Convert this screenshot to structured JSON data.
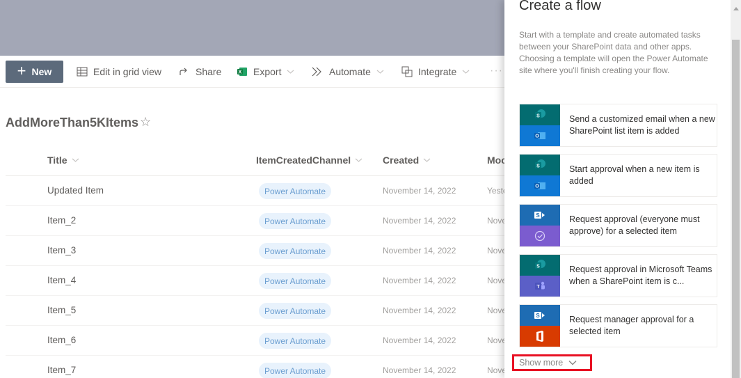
{
  "command_bar": {
    "new_label": "New",
    "edit_grid_label": "Edit in grid view",
    "share_label": "Share",
    "export_label": "Export",
    "automate_label": "Automate",
    "integrate_label": "Integrate",
    "more_label": "···"
  },
  "list": {
    "title": "AddMoreThan5KItems",
    "columns": {
      "title": "Title",
      "channel": "ItemCreatedChannel",
      "created": "Created",
      "modified": "Moc"
    },
    "rows": [
      {
        "title": "Updated Item",
        "channel": "Power Automate",
        "created": "November 14, 2022",
        "modified": "Yeste"
      },
      {
        "title": "Item_2",
        "channel": "Power Automate",
        "created": "November 14, 2022",
        "modified": "Nove"
      },
      {
        "title": "Item_3",
        "channel": "Power Automate",
        "created": "November 14, 2022",
        "modified": "Nove"
      },
      {
        "title": "Item_4",
        "channel": "Power Automate",
        "created": "November 14, 2022",
        "modified": "Nove"
      },
      {
        "title": "Item_5",
        "channel": "Power Automate",
        "created": "November 14, 2022",
        "modified": "Nove"
      },
      {
        "title": "Item_6",
        "channel": "Power Automate",
        "created": "November 14, 2022",
        "modified": "Nove"
      },
      {
        "title": "Item_7",
        "channel": "Power Automate",
        "created": "November 14, 2022",
        "modified": "Nove"
      }
    ]
  },
  "panel": {
    "title": "Create a flow",
    "description": "Start with a template and create automated tasks between your SharePoint data and other apps. Choosing a template will open the Power Automate site where you'll finish creating your flow.",
    "templates": [
      {
        "text": "Send a customized email when a new SharePoint list item is added",
        "top_icon": "sharepoint-icon",
        "bottom_icon": "outlook-icon"
      },
      {
        "text": "Start approval when a new item is added",
        "top_icon": "sharepoint-icon",
        "bottom_icon": "outlook-icon"
      },
      {
        "text": "Request approval (everyone must approve) for a selected item",
        "top_icon": "sharepoint-icon",
        "bottom_icon": "approvals-icon"
      },
      {
        "text": "Request approval in Microsoft Teams when a SharePoint item is c...",
        "top_icon": "sharepoint-icon",
        "bottom_icon": "teams-icon"
      },
      {
        "text": "Request manager approval for a selected item",
        "top_icon": "sharepoint-icon",
        "bottom_icon": "office-icon"
      }
    ],
    "show_more_label": "Show more"
  },
  "colors": {
    "sharepoint_teal": "#036c70",
    "sharepoint_blue": "#1e6cb3",
    "outlook_blue": "#0f78d4",
    "approvals_purple": "#7b5ccf",
    "teams_purple": "#5b5fc7",
    "office_orange": "#d83b01",
    "highlight_red": "#e81123",
    "pill_bg": "#e8f2fc"
  }
}
